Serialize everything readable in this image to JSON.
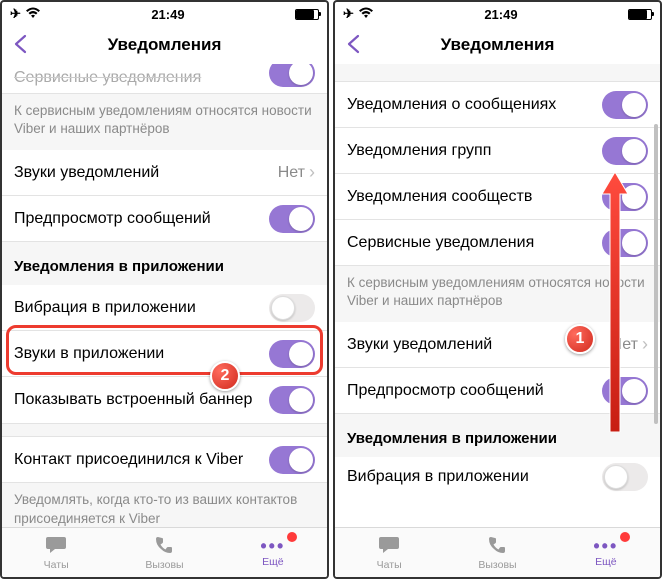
{
  "status": {
    "time": "21:49"
  },
  "nav": {
    "title": "Уведомления"
  },
  "left": {
    "partialTop": "Сервисные уведомления",
    "note1": "К сервисным уведомлениям относятся новости Viber и наших партнёров",
    "rows": {
      "sounds": {
        "label": "Звуки уведомлений",
        "value": "Нет"
      },
      "preview": "Предпросмотр сообщений"
    },
    "section1": "Уведомления в приложении",
    "section1rows": {
      "vibration": "Вибрация в приложении",
      "soundsApp": "Звуки в приложении",
      "banner": "Показывать встроенный баннер"
    },
    "joined": "Контакт присоединился к Viber",
    "note2": "Уведомлять, когда кто-то из ваших контактов присоединяется к Viber"
  },
  "right": {
    "rows": {
      "msg": "Уведомления о сообщениях",
      "groups": "Уведомления групп",
      "comm": "Уведомления сообществ",
      "service": "Сервисные уведомления"
    },
    "note1": "К сервисным уведомлениям относятся новости Viber и наших партнёров",
    "sounds": {
      "label": "Звуки уведомлений",
      "value": "Нет"
    },
    "preview": "Предпросмотр сообщений",
    "section1": "Уведомления в приложении",
    "vibration": "Вибрация в приложении"
  },
  "tabs": {
    "chats": "Чаты",
    "calls": "Вызовы",
    "more": "Ещё"
  },
  "badges": {
    "step1": "1",
    "step2": "2"
  }
}
